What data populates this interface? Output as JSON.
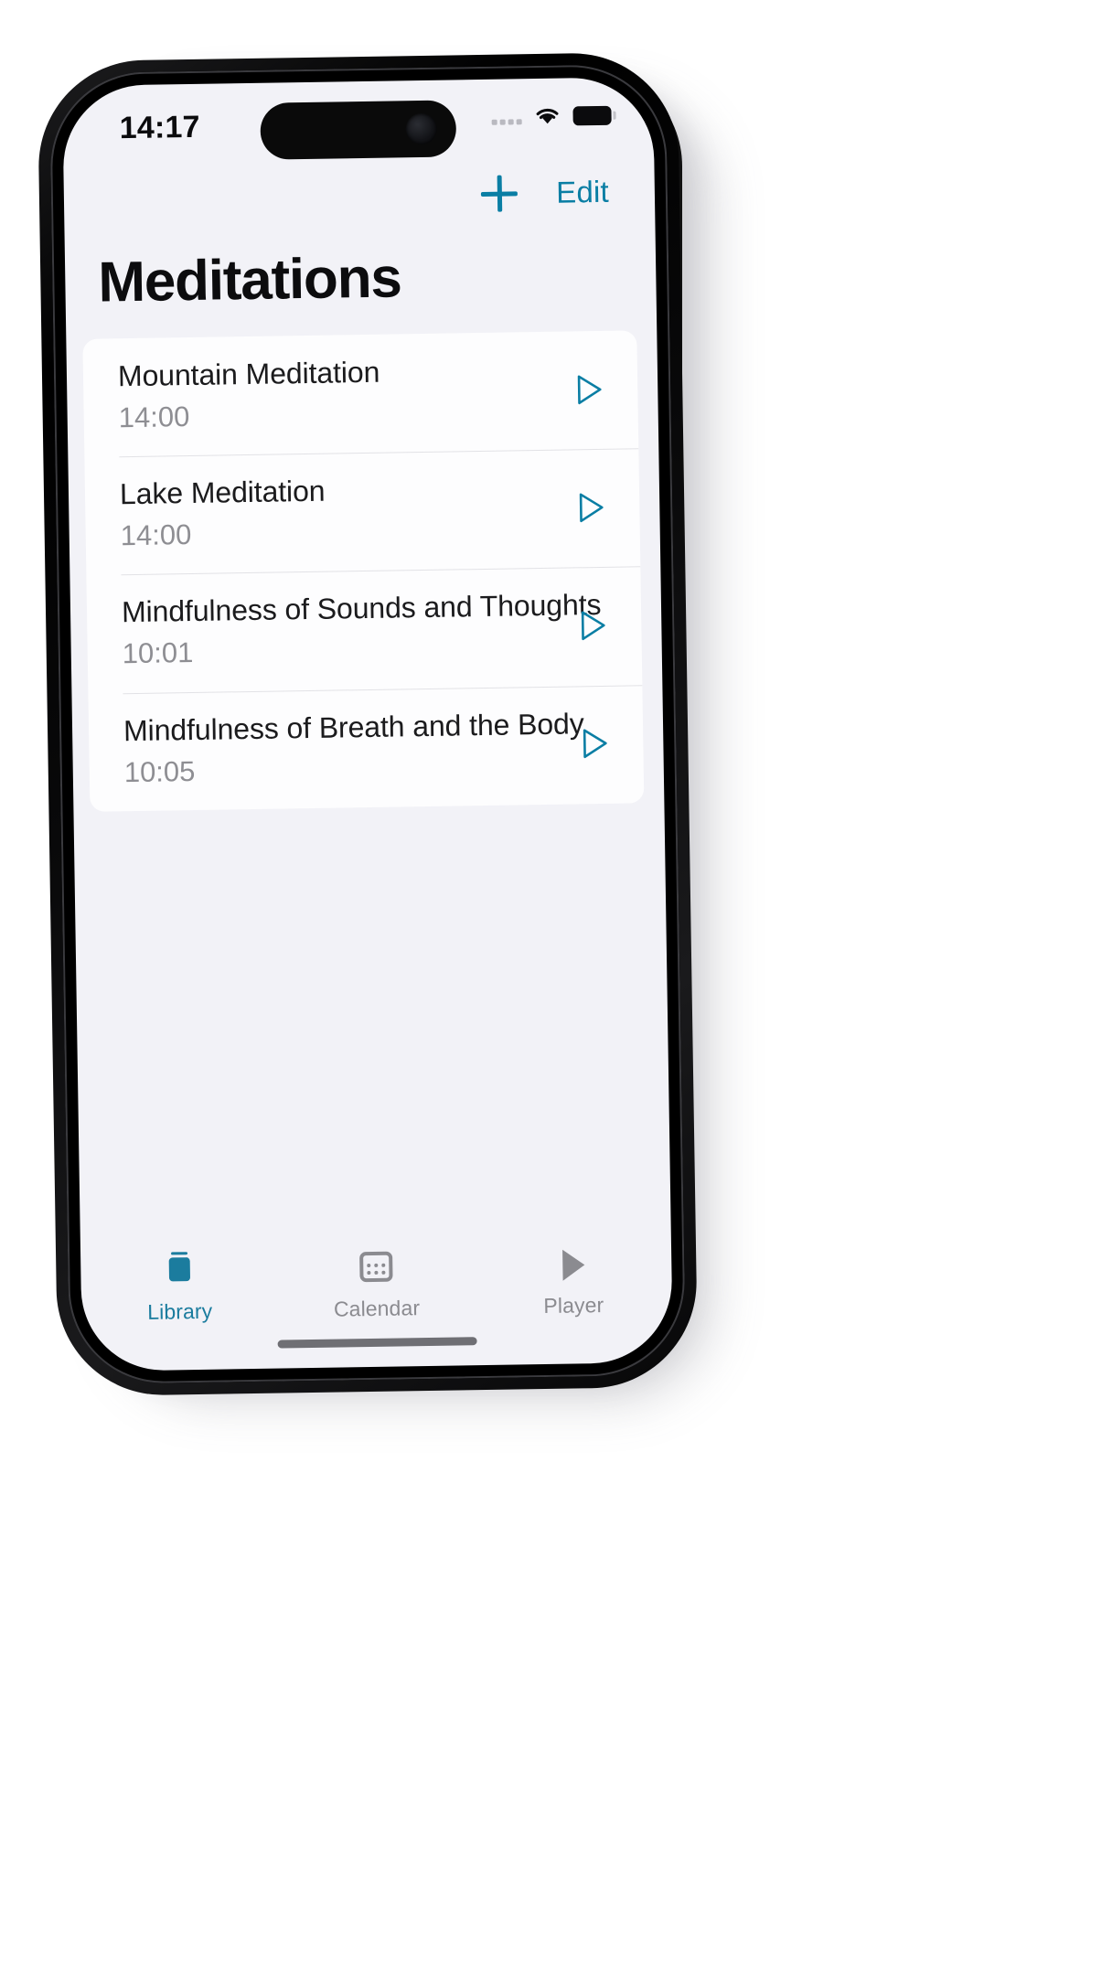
{
  "status_bar": {
    "time": "14:17",
    "signal_icon": "cellular-signal-icon",
    "wifi_icon": "wifi-icon",
    "battery_icon": "battery-full-icon"
  },
  "toolbar": {
    "add_label": "+",
    "add_icon": "plus-icon",
    "edit_label": "Edit",
    "accent_color": "#0a7ea4"
  },
  "page": {
    "title": "Meditations"
  },
  "list": {
    "items": [
      {
        "title": "Mountain Meditation",
        "duration": "14:00",
        "play_icon": "play-triangle-icon"
      },
      {
        "title": "Lake Meditation",
        "duration": "14:00",
        "play_icon": "play-triangle-icon"
      },
      {
        "title": "Mindfulness of Sounds and Thoughts",
        "duration": "10:01",
        "play_icon": "play-triangle-icon"
      },
      {
        "title": "Mindfulness of Breath and the Body",
        "duration": "10:05",
        "play_icon": "play-triangle-icon"
      }
    ]
  },
  "tabbar": {
    "active_color": "#1b7c9e",
    "inactive_color": "#8b8b90",
    "tabs": [
      {
        "label": "Library",
        "icon": "library-jar-icon",
        "active": true
      },
      {
        "label": "Calendar",
        "icon": "calendar-icon",
        "active": false
      },
      {
        "label": "Player",
        "icon": "play-filled-icon",
        "active": false
      }
    ]
  }
}
